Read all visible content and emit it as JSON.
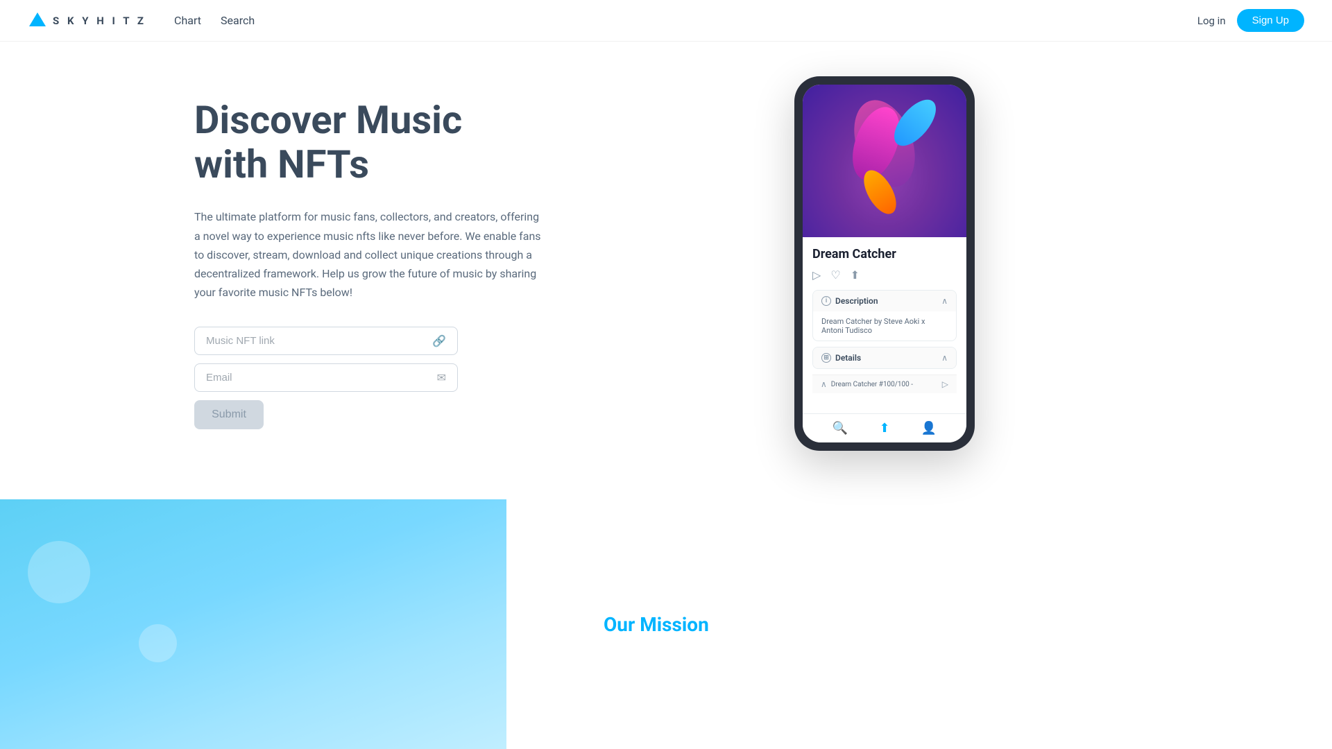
{
  "brand": {
    "logo_text": "S K Y H I T Z",
    "logo_icon": "▲"
  },
  "navbar": {
    "chart_label": "Chart",
    "search_label": "Search",
    "login_label": "Log in",
    "signup_label": "Sign Up"
  },
  "hero": {
    "title_line1": "Discover Music",
    "title_line2": "with NFTs",
    "description": "The ultimate platform for music fans, collectors, and creators, offering a novel way to experience music nfts like never before. We enable fans to discover, stream, download and collect unique creations through a decentralized framework.  Help us grow the future of music by sharing your favorite music NFTs below!",
    "input_nft_placeholder": "Music NFT link",
    "input_email_placeholder": "Email",
    "submit_label": "Submit"
  },
  "phone_mockup": {
    "track_name": "Dream Catcher",
    "description_section": {
      "label": "Description",
      "content": "Dream Catcher by Steve Aoki x Antoni Tudisco"
    },
    "details_section": {
      "label": "Details",
      "footer_text": "Dream Catcher #100/100 -"
    }
  },
  "mission": {
    "title": "Our Mission"
  }
}
